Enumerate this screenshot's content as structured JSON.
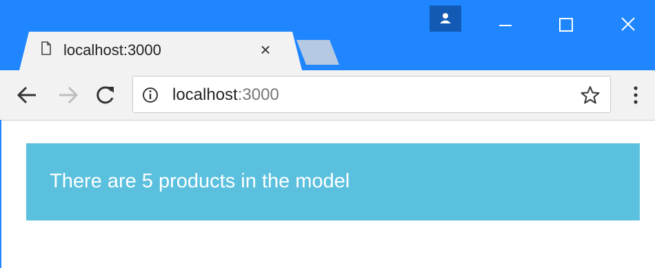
{
  "tab": {
    "title": "localhost:3000",
    "close_glyph": "×"
  },
  "address_bar": {
    "host": "localhost",
    "port": ":3000"
  },
  "page": {
    "message": "There are 5 products in the model"
  },
  "colors": {
    "titlebar": "#1f86ff",
    "banner": "#5bc0de",
    "profile_button": "#135ab4"
  },
  "icons": {
    "page": "document-icon",
    "new_tab": "new-tab-icon",
    "profile": "user-icon",
    "minimize": "minimize-icon",
    "maximize": "maximize-icon",
    "close": "close-icon",
    "back": "back-arrow-icon",
    "forward": "forward-arrow-icon",
    "reload": "reload-icon",
    "info": "info-icon",
    "bookmark": "star-icon",
    "menu": "kebab-menu-icon"
  }
}
